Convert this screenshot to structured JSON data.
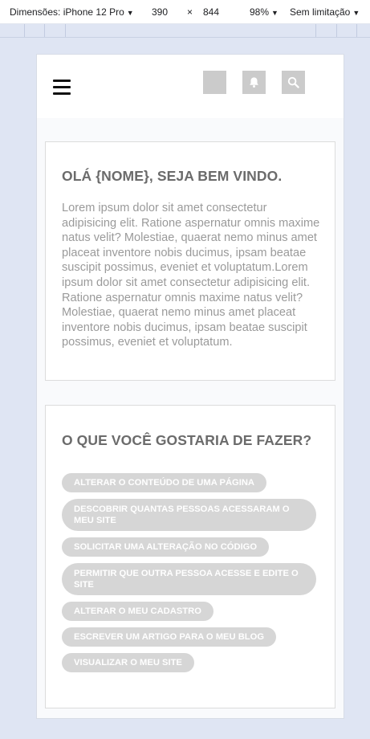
{
  "devtools": {
    "device_label": "Dimensões: iPhone 12 Pro",
    "width": "390",
    "times": "×",
    "height": "844",
    "zoom": "98%",
    "throttle": "Sem limitação"
  },
  "header": {
    "menu_icon": "hamburger-icon",
    "icons": [
      "blank-square",
      "bell-icon",
      "search-icon"
    ]
  },
  "welcome": {
    "title": "OLÁ {NOME}, SEJA BEM VINDO.",
    "text": "Lorem ipsum dolor sit amet consectetur adipisicing elit. Ratione aspernatur omnis maxime natus velit? Molestiae, quaerat nemo minus amet placeat inventore nobis ducimus, ipsam beatae suscipit possimus, eveniet et voluptatum.Lorem ipsum dolor sit amet consectetur adipisicing elit. Ratione aspernatur omnis maxime natus velit? Molestiae, quaerat nemo minus amet placeat inventore nobis ducimus, ipsam beatae suscipit possimus, eveniet et voluptatum."
  },
  "actions": {
    "title": "O QUE VOCÊ GOSTARIA DE FAZER?",
    "items": [
      "ALTERAR O CONTEÚDO DE UMA PÁGINA",
      "DESCOBRIR QUANTAS PESSOAS ACESSARAM O MEU SITE",
      "SOLICITAR UMA ALTERAÇÃO NO CÓDIGO",
      "PERMITIR QUE OUTRA PESSOA ACESSE E EDITE O SITE",
      "ALTERAR O MEU CADASTRO",
      "ESCREVER UM ARTIGO PARA O MEU BLOG",
      "VISUALIZAR O MEU SITE"
    ]
  },
  "colors": {
    "page_bg": "#dfe5f3",
    "pill_bg": "#d6d6d6",
    "icon_button_bg": "#cbcbcb",
    "title_text": "#6b6b6b",
    "body_text": "#9a9a9a"
  }
}
